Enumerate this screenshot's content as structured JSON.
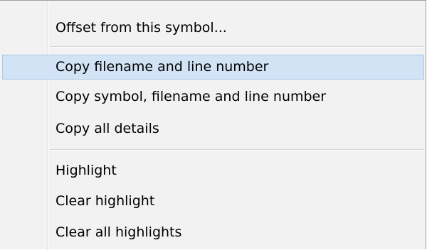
{
  "menu": {
    "group1": [
      {
        "label": "Offset from this symbol..."
      }
    ],
    "group2": [
      {
        "label": "Copy filename and line number",
        "highlighted": true
      },
      {
        "label": "Copy symbol, filename and line number"
      },
      {
        "label": "Copy all details"
      }
    ],
    "group3": [
      {
        "label": "Highlight"
      },
      {
        "label": "Clear highlight"
      },
      {
        "label": "Clear all highlights"
      }
    ]
  }
}
